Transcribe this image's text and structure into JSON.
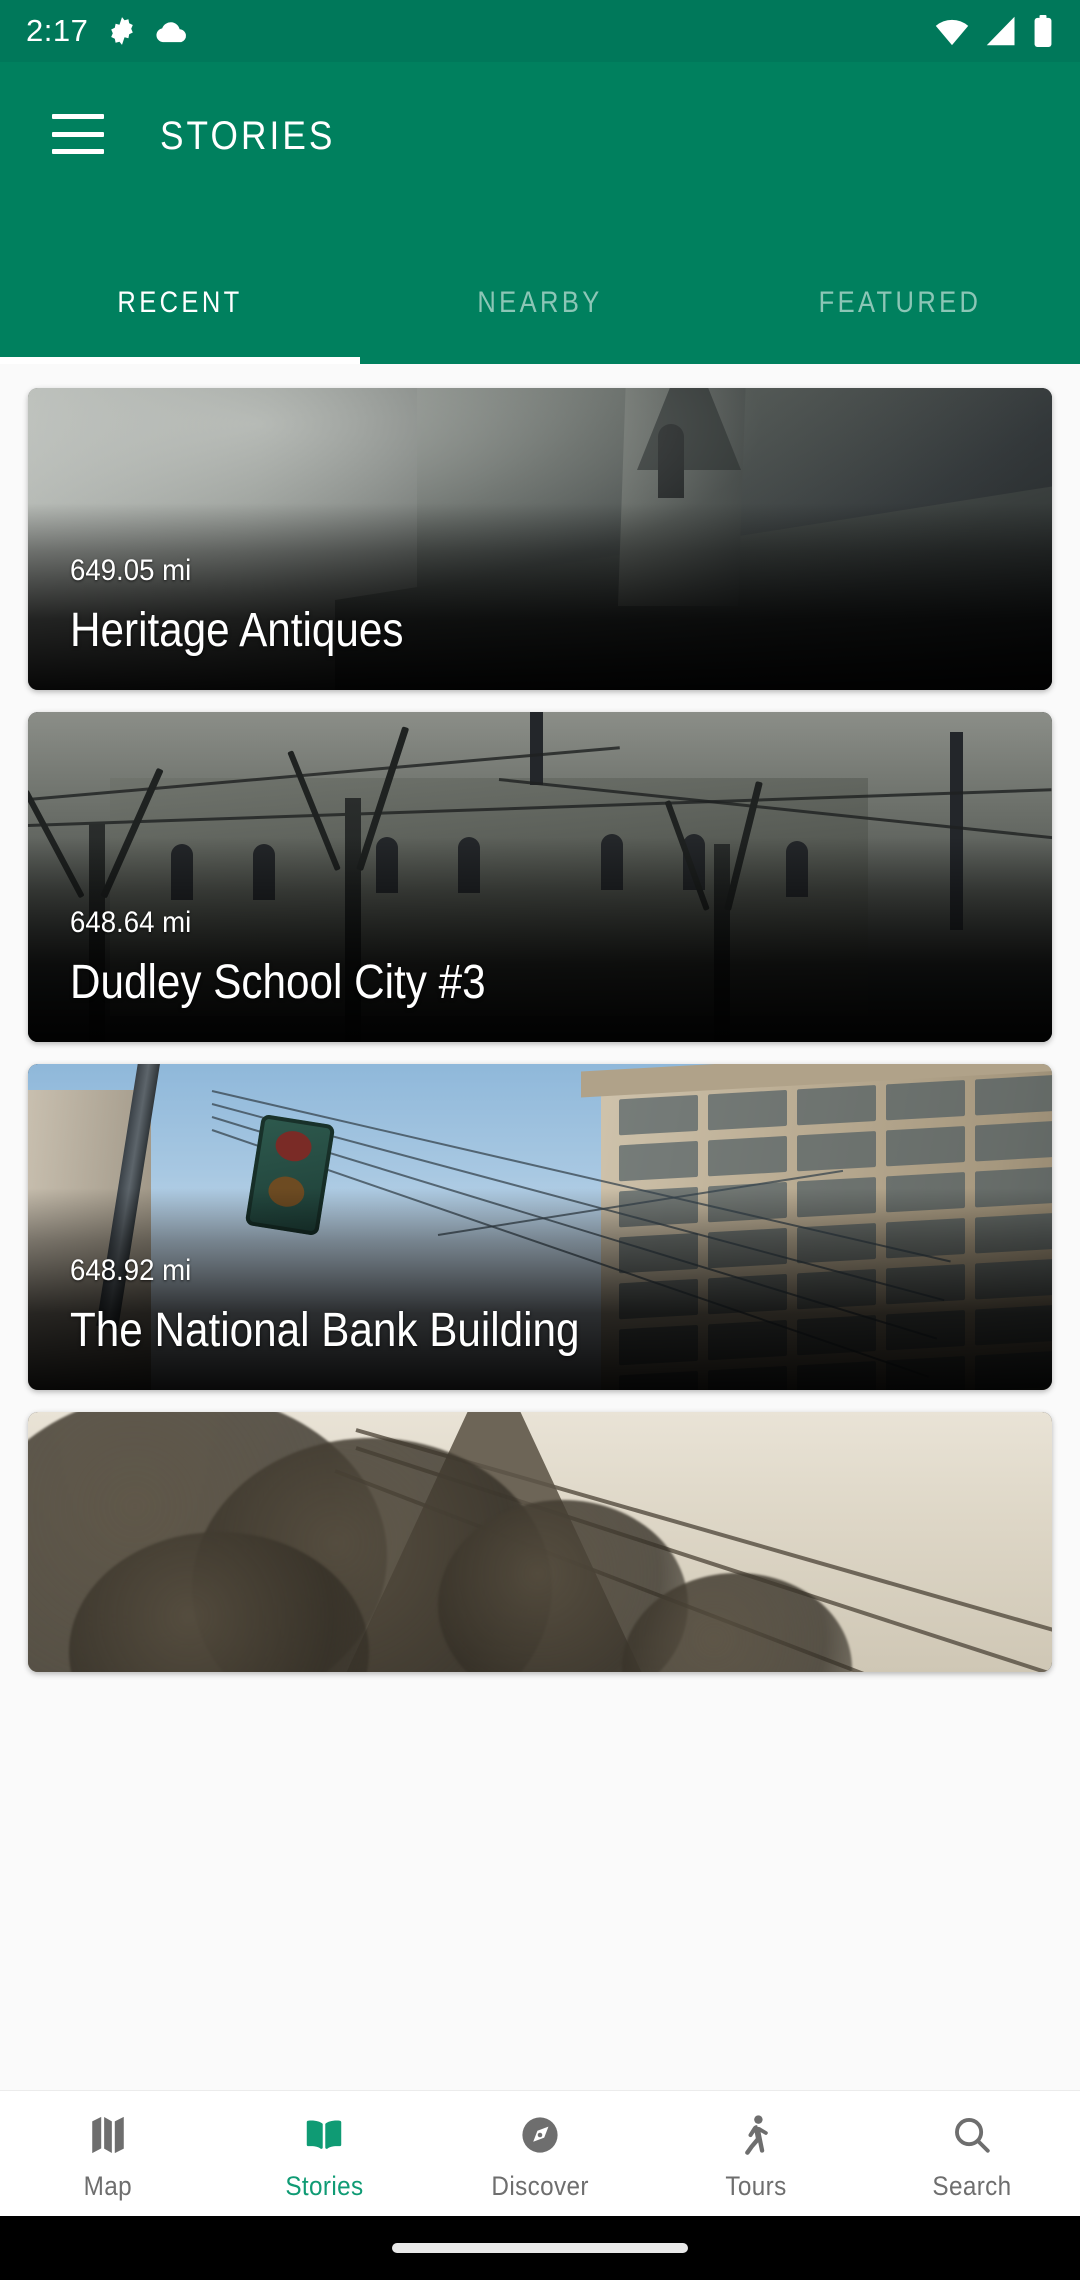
{
  "status_bar": {
    "time": "2:17",
    "left_icons": [
      "gear-icon",
      "cloud-icon"
    ],
    "right_icons": [
      "wifi-icon",
      "cellular-signal-icon",
      "battery-icon"
    ]
  },
  "app_bar": {
    "menu_icon": "hamburger-menu-icon",
    "title": "STORIES",
    "background_color": "#00805e"
  },
  "tabs": {
    "active_index": 0,
    "items": [
      {
        "label": "RECENT"
      },
      {
        "label": "NEARBY"
      },
      {
        "label": "FEATURED"
      }
    ]
  },
  "stories": [
    {
      "distance": "649.05 mi",
      "title": "Heritage Antiques",
      "photo": "black-and-white church steeple"
    },
    {
      "distance": "648.64 mi",
      "title": "Dudley School City #3",
      "photo": "black-and-white courthouse with bare trees"
    },
    {
      "distance": "648.92 mi",
      "title": "The National Bank Building",
      "photo": "color photo of tall brick tower with traffic signal"
    },
    {
      "distance": "",
      "title": "",
      "photo": "sepia church behind trees and power lines"
    }
  ],
  "bottom_nav": {
    "active_index": 1,
    "active_color": "#0f9b74",
    "inactive_color": "#6e6e6e",
    "items": [
      {
        "label": "Map",
        "icon": "map-icon"
      },
      {
        "label": "Stories",
        "icon": "open-book-icon"
      },
      {
        "label": "Discover",
        "icon": "compass-icon"
      },
      {
        "label": "Tours",
        "icon": "walking-person-icon"
      },
      {
        "label": "Search",
        "icon": "search-icon"
      }
    ]
  },
  "gesture_bar": {
    "handle": "home-gesture-pill"
  }
}
